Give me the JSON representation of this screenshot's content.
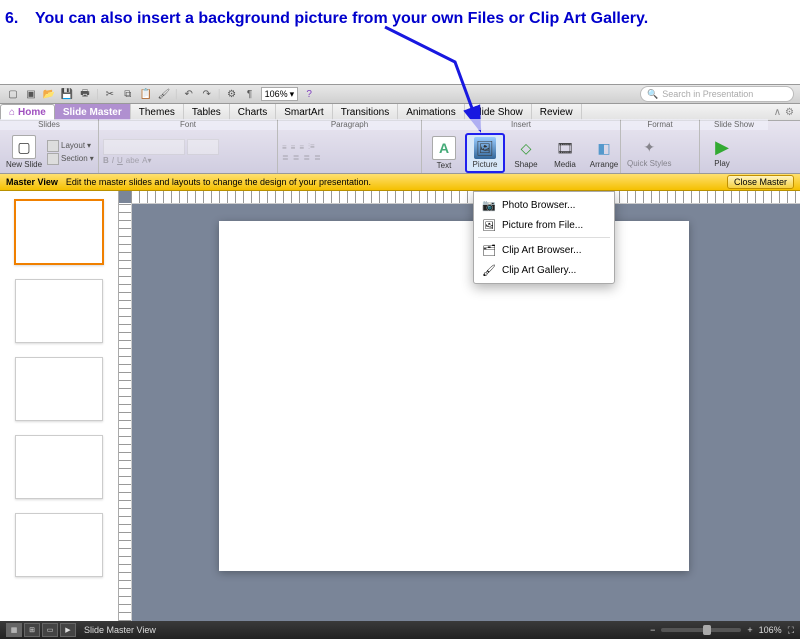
{
  "instruction": {
    "number": "6.",
    "text": "You can also insert a background picture from your own Files or Clip Art Gallery."
  },
  "titlebar": {
    "zoom": "106%",
    "search_placeholder": "Search in Presentation"
  },
  "tabs": [
    "Home",
    "Slide Master",
    "Themes",
    "Tables",
    "Charts",
    "SmartArt",
    "Transitions",
    "Animations",
    "Slide Show",
    "Review"
  ],
  "active_tab": "Slide Master",
  "ribbon": {
    "groups": {
      "slides": "Slides",
      "font": "Font",
      "paragraph": "Paragraph",
      "insert": "Insert",
      "format": "Format",
      "slideshow": "Slide Show"
    },
    "new_slide": "New Slide",
    "layout": "Layout",
    "section": "Section",
    "text": "Text",
    "picture": "Picture",
    "shape": "Shape",
    "media": "Media",
    "arrange": "Arrange",
    "quick_styles": "Quick Styles",
    "play": "Play"
  },
  "masterbar": {
    "label": "Master View",
    "hint": "Edit the master slides and layouts to change the design of your presentation.",
    "close": "Close Master"
  },
  "dropdown": {
    "photo_browser": "Photo Browser...",
    "picture_from_file": "Picture from File...",
    "clip_art_browser": "Clip Art Browser...",
    "clip_art_gallery": "Clip Art Gallery..."
  },
  "status": {
    "view_label": "Slide Master View",
    "zoom": "106%"
  }
}
